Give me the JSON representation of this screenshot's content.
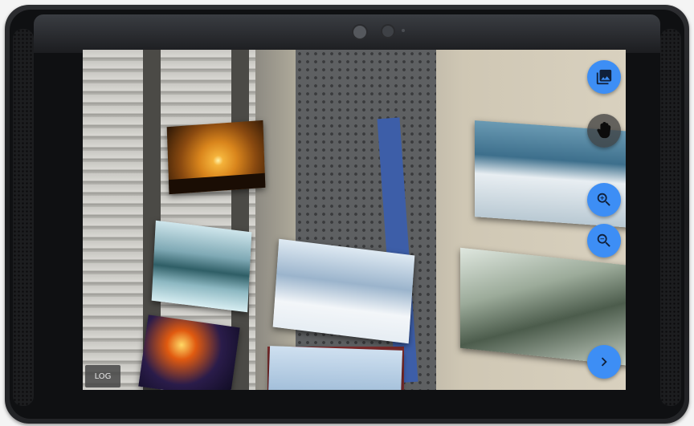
{
  "screen": {
    "log_label": "LOG"
  },
  "toolbar": {
    "buttons": [
      {
        "name": "gallery",
        "icon": "photo-library-icon"
      },
      {
        "name": "move",
        "icon": "hand-icon"
      },
      {
        "name": "zoom-in",
        "icon": "zoom-in-icon"
      },
      {
        "name": "zoom-out",
        "icon": "zoom-out-icon"
      },
      {
        "name": "next",
        "icon": "chevron-right-icon"
      }
    ],
    "accent_color": "#3d8ef5"
  },
  "ar_photos": [
    {
      "name": "elephant-sunset"
    },
    {
      "name": "frozen-forest-lake"
    },
    {
      "name": "fireworks"
    },
    {
      "name": "snowy-pine-trees"
    },
    {
      "name": "snowy-mountains"
    },
    {
      "name": "winter-path"
    }
  ]
}
